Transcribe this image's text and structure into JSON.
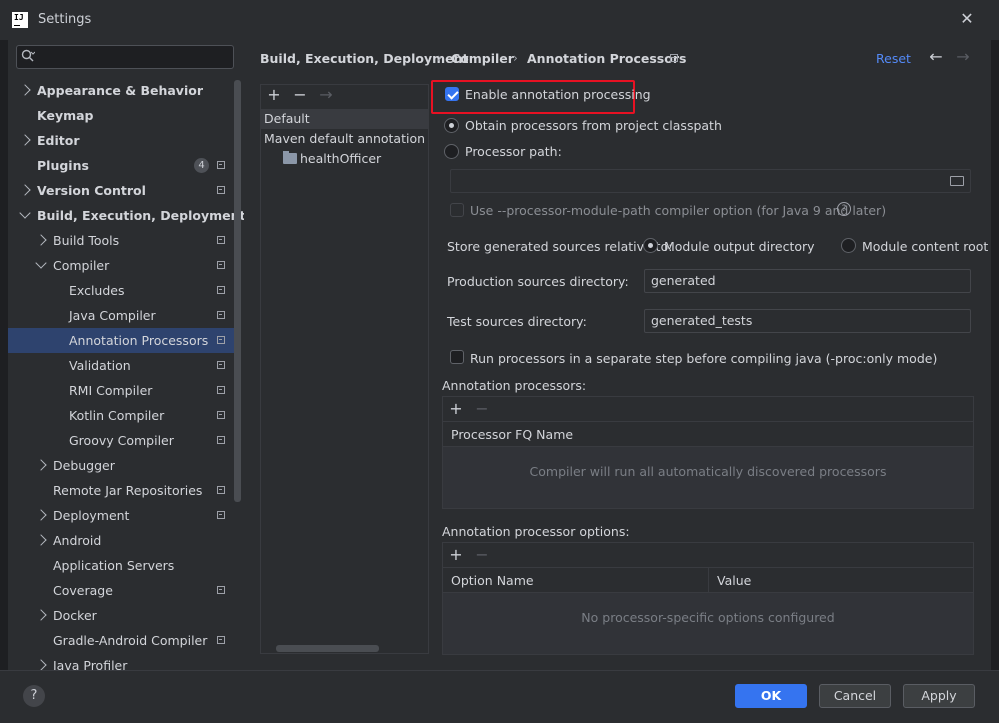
{
  "window": {
    "title": "Settings",
    "app_icon_text": "IJ"
  },
  "search": {
    "placeholder": ""
  },
  "sidebar": {
    "items": [
      {
        "label": "Appearance & Behavior"
      },
      {
        "label": "Keymap"
      },
      {
        "label": "Editor"
      },
      {
        "label": "Plugins",
        "badge": "4"
      },
      {
        "label": "Version Control"
      },
      {
        "label": "Build, Execution, Deployment"
      },
      {
        "label": "Build Tools"
      },
      {
        "label": "Compiler"
      },
      {
        "label": "Excludes"
      },
      {
        "label": "Java Compiler"
      },
      {
        "label": "Annotation Processors"
      },
      {
        "label": "Validation"
      },
      {
        "label": "RMI Compiler"
      },
      {
        "label": "Kotlin Compiler"
      },
      {
        "label": "Groovy Compiler"
      },
      {
        "label": "Debugger"
      },
      {
        "label": "Remote Jar Repositories"
      },
      {
        "label": "Deployment"
      },
      {
        "label": "Android"
      },
      {
        "label": "Application Servers"
      },
      {
        "label": "Coverage"
      },
      {
        "label": "Docker"
      },
      {
        "label": "Gradle-Android Compiler"
      },
      {
        "label": "Java Profiler"
      }
    ]
  },
  "breadcrumb": {
    "items": [
      "Build, Execution, Deployment",
      "Compiler",
      "Annotation Processors"
    ],
    "separator": "›"
  },
  "header": {
    "reset_label": "Reset",
    "back": "←",
    "forward": "→"
  },
  "profiles": {
    "add": "+",
    "remove": "−",
    "move": "→",
    "rows": [
      "Default",
      "Maven default annotation processors profile",
      "healthOfficer"
    ]
  },
  "settings": {
    "enable_label": "Enable annotation processing",
    "obtain_label": "Obtain processors from project classpath",
    "path_label": "Processor path:",
    "path_value": "",
    "module_path_label": "Use --processor-module-path compiler option (for Java 9 and later)",
    "help_glyph": "?",
    "store_label": "Store generated sources relative to:",
    "module_output_label": "Module output directory",
    "module_content_label": "Module content root",
    "prod_label": "Production sources directory:",
    "prod_value": "generated",
    "test_label": "Test sources directory:",
    "test_value": "generated_tests",
    "run_separate_label": "Run processors in a separate step before compiling java (-proc:only mode)"
  },
  "processors_table": {
    "title": "Annotation processors:",
    "add": "+",
    "remove": "−",
    "column": "Processor FQ Name",
    "empty": "Compiler will run all automatically discovered processors"
  },
  "options_table": {
    "title": "Annotation processor options:",
    "add": "+",
    "remove": "−",
    "columns": [
      "Option Name",
      "Value"
    ],
    "empty": "No processor-specific options configured"
  },
  "footer": {
    "help": "?",
    "ok": "OK",
    "cancel": "Cancel",
    "apply": "Apply"
  },
  "colors": {
    "accent": "#3574f0",
    "link": "#548af7",
    "highlight": "#e81123",
    "selected": "#2e436e"
  }
}
